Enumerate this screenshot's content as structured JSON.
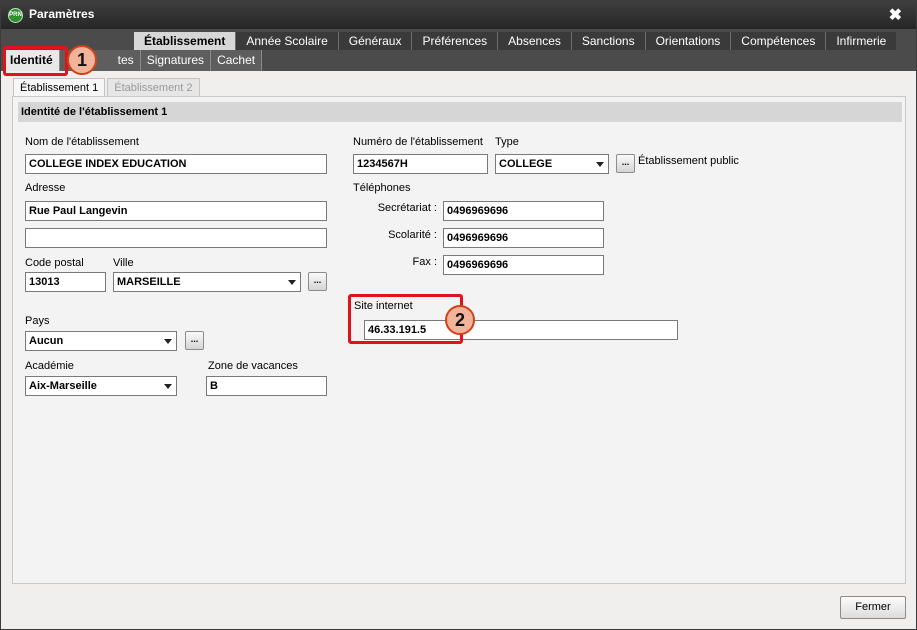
{
  "window": {
    "title": "Paramètres",
    "app_icon_text": "PRN",
    "close_glyph": "✖"
  },
  "top_tabs": [
    {
      "label": "Établissement",
      "active": true
    },
    {
      "label": "Année Scolaire",
      "active": false
    },
    {
      "label": "Généraux",
      "active": false
    },
    {
      "label": "Préférences",
      "active": false
    },
    {
      "label": "Absences",
      "active": false
    },
    {
      "label": "Sanctions",
      "active": false
    },
    {
      "label": "Orientations",
      "active": false
    },
    {
      "label": "Compétences",
      "active": false
    },
    {
      "label": "Infirmerie",
      "active": false
    }
  ],
  "sub_tabs": [
    {
      "label": "Identité",
      "active": true
    },
    {
      "label": "tes",
      "active": false
    },
    {
      "label": "Signatures",
      "active": false
    },
    {
      "label": "Cachet",
      "active": false
    }
  ],
  "inner_tabs": [
    {
      "label": "Établissement 1",
      "active": true
    },
    {
      "label": "Établissement 2",
      "active": false
    }
  ],
  "section": {
    "title": "Identité de l'établissement 1"
  },
  "form": {
    "nom_label": "Nom de l'établissement",
    "nom_value": "COLLEGE INDEX EDUCATION",
    "adresse_label": "Adresse",
    "adresse_1": "Rue Paul Langevin",
    "adresse_2": "",
    "code_postal_label": "Code postal",
    "code_postal_value": "13013",
    "ville_label": "Ville",
    "ville_value": "MARSEILLE",
    "pays_label": "Pays",
    "pays_value": "Aucun",
    "academie_label": "Académie",
    "academie_value": "Aix-Marseille",
    "zone_label": "Zone de vacances",
    "zone_value": "B",
    "numero_label": "Numéro de l'établissement",
    "numero_value": "1234567H",
    "type_label": "Type",
    "type_value": "COLLEGE",
    "etablissement_public": "Établissement public",
    "telephones_label": "Téléphones",
    "secretariat_label": "Secrétariat :",
    "secretariat_value": "0496969696",
    "scolarite_label": "Scolarité :",
    "scolarite_value": "0496969696",
    "fax_label": "Fax :",
    "fax_value": "0496969696",
    "site_label": "Site internet",
    "site_value": "46.33.191.5",
    "dots": "..."
  },
  "annotations": {
    "badge_1": "1",
    "badge_2": "2",
    "highlight_color": "#e0121b"
  },
  "footer": {
    "close_label": "Fermer"
  }
}
